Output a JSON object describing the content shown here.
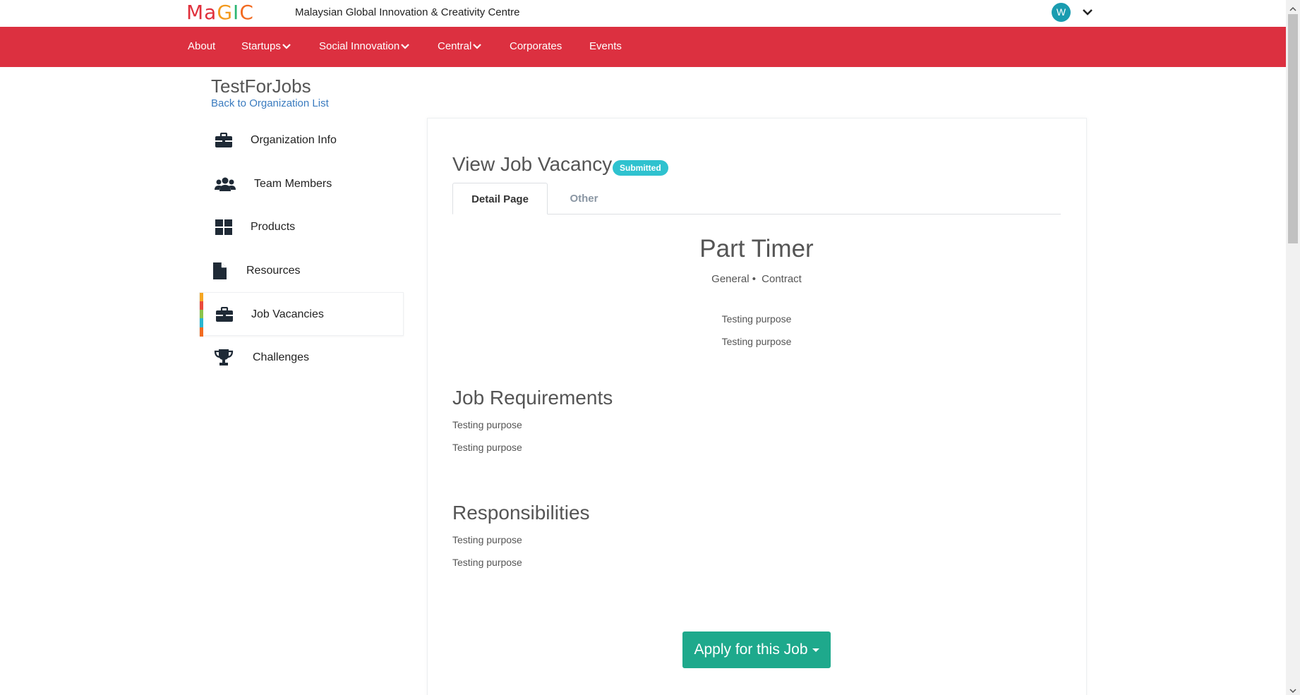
{
  "brand": {
    "logo": {
      "m": "M",
      "a": "a",
      "g": "G",
      "i": "I",
      "c": "C"
    },
    "name": "Malaysian Global Innovation & Creativity Centre",
    "avatar_letter": "W"
  },
  "nav": {
    "items": [
      {
        "label": "About",
        "has_dropdown": false
      },
      {
        "label": "Startups",
        "has_dropdown": true
      },
      {
        "label": "Social Innovation",
        "has_dropdown": true
      },
      {
        "label": "Central",
        "has_dropdown": true
      },
      {
        "label": "Corporates",
        "has_dropdown": false
      },
      {
        "label": "Events",
        "has_dropdown": false
      }
    ]
  },
  "org": {
    "title": "TestForJobs",
    "back_link": "Back to Organization List"
  },
  "sidebar": {
    "items": [
      {
        "label": "Organization Info",
        "icon": "briefcase-icon"
      },
      {
        "label": "Team Members",
        "icon": "users-icon"
      },
      {
        "label": "Products",
        "icon": "grid-icon"
      },
      {
        "label": "Resources",
        "icon": "file-icon"
      },
      {
        "label": "Job Vacancies",
        "icon": "briefcase-icon",
        "active": true
      },
      {
        "label": "Challenges",
        "icon": "trophy-icon"
      }
    ]
  },
  "main": {
    "title": "View Job Vacancy",
    "status_badge": "Submitted",
    "tabs": [
      {
        "label": "Detail Page",
        "active": true
      },
      {
        "label": "Other",
        "active": false
      }
    ],
    "job": {
      "title": "Part Timer",
      "category": "General",
      "separator": "•",
      "type": "Contract",
      "description": [
        "Testing purpose",
        "Testing purpose"
      ]
    },
    "requirements": {
      "heading": "Job Requirements",
      "lines": [
        "Testing purpose",
        "Testing purpose"
      ]
    },
    "responsibilities": {
      "heading": "Responsibilities",
      "lines": [
        "Testing purpose",
        "Testing purpose"
      ]
    },
    "apply_button": "Apply for this Job"
  },
  "colors": {
    "nav_bg": "#dc3040",
    "badge": "#2fc2cf",
    "apply_button": "#1ea98c",
    "link": "#3a7bbf",
    "avatar": "#1a9cb0"
  }
}
